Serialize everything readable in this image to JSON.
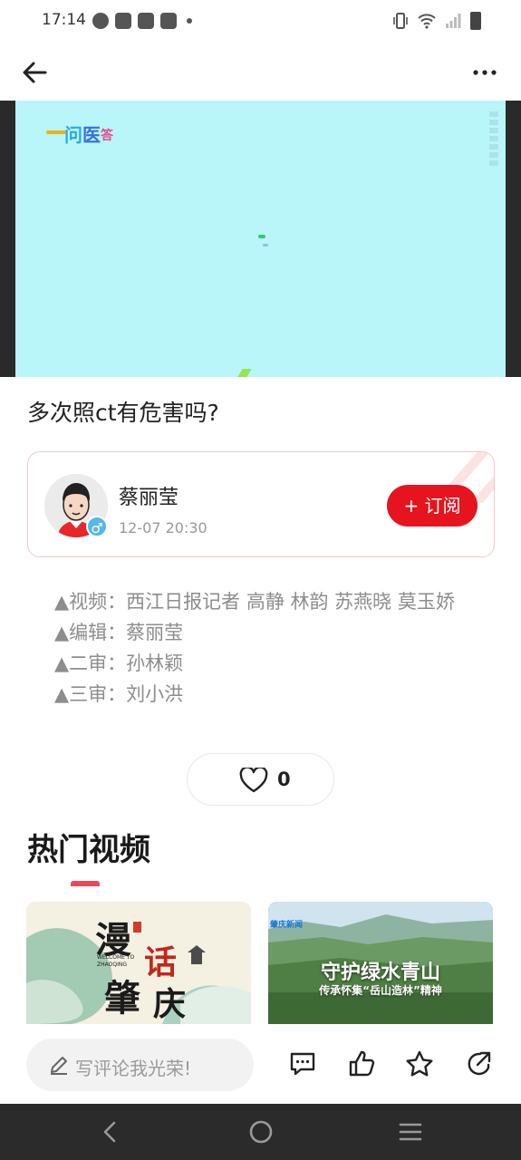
{
  "status_bar": {
    "time": "17:14"
  },
  "video": {
    "logo_chars": [
      "问",
      "医",
      "答"
    ],
    "logo_prefix": "一"
  },
  "article": {
    "title": "多次照ct有危害吗?"
  },
  "author": {
    "name": "蔡丽莹",
    "time": "12-07 20:30",
    "gender_symbol": "♂",
    "subscribe_label": "+ 订阅"
  },
  "credits": {
    "lines": [
      "▲视频：西江日报记者 高静 林韵 苏燕晓 莫玉娇",
      "▲编辑：蔡丽莹",
      "▲二审：孙林颖",
      "▲三审：刘小洪"
    ]
  },
  "like": {
    "count": "0"
  },
  "hot_videos": {
    "title": "热门视频",
    "items": [
      {
        "chars": [
          "漫",
          "话",
          "肇",
          "庆"
        ],
        "small_text": "WELCOME TO ZHAOQING"
      },
      {
        "brand": "肇庆新闻",
        "headline": "守护绿水青山",
        "subline": "传承怀集“岳山造林”精神"
      }
    ]
  },
  "comment_bar": {
    "placeholder": "写评论我光荣!"
  },
  "icons": {
    "back": "arrow-left-icon",
    "more": "more-dots-icon",
    "like": "heart-icon",
    "comment": "comment-icon",
    "thumb_up": "thumb-up-icon",
    "favorite": "star-icon",
    "share": "share-icon"
  },
  "colors": {
    "accent": "#e5141e",
    "video_bg": "#b9f6fa",
    "gender_badge": "#56b7e9"
  }
}
